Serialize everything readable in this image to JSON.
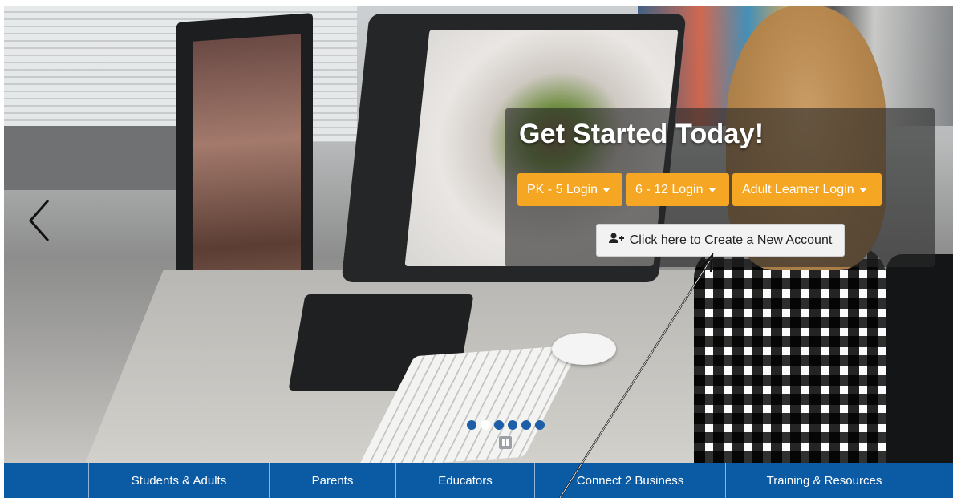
{
  "hero": {
    "image_description_icon": "photo-background",
    "cta": {
      "title": "Get Started Today!",
      "login_buttons": [
        {
          "label": "PK - 5 Login"
        },
        {
          "label": "6 - 12 Login"
        },
        {
          "label": "Adult Learner Login"
        }
      ],
      "create_account_label": "Click here to Create a New Account",
      "create_account_icon": "user-plus-icon"
    },
    "carousel": {
      "prev_icon": "chevron-left-icon",
      "active_slide": 2,
      "slide_count": 6,
      "pause_icon": "pause-icon"
    }
  },
  "nav": {
    "items": [
      {
        "label": "Students & Adults"
      },
      {
        "label": "Parents"
      },
      {
        "label": "Educators"
      },
      {
        "label": "Connect 2 Business"
      },
      {
        "label": "Training & Resources"
      }
    ]
  },
  "colors": {
    "accent": "#f5a623",
    "nav_bg": "#0b5aa4",
    "dot": "#1c5ea8"
  }
}
